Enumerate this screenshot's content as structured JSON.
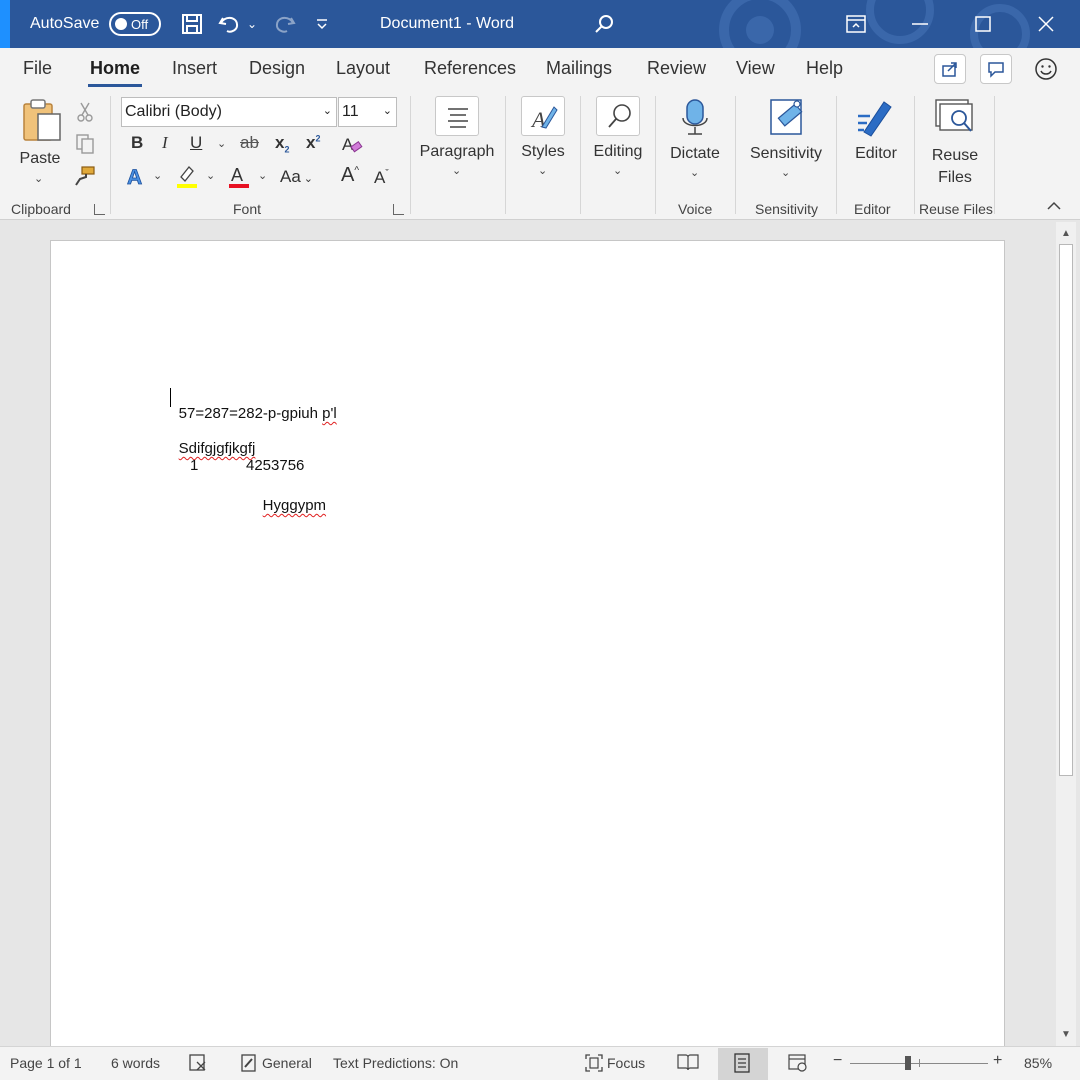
{
  "titlebar": {
    "autosave_label": "AutoSave",
    "autosave_state": "Off",
    "document_title": "Document1  -  Word",
    "accent_color": "#2b579a"
  },
  "tabs": [
    {
      "label": "File"
    },
    {
      "label": "Home",
      "active": true
    },
    {
      "label": "Insert"
    },
    {
      "label": "Design"
    },
    {
      "label": "Layout"
    },
    {
      "label": "References"
    },
    {
      "label": "Mailings"
    },
    {
      "label": "Review"
    },
    {
      "label": "View"
    },
    {
      "label": "Help"
    }
  ],
  "ribbon": {
    "clipboard": {
      "paste_label": "Paste",
      "group_label": "Clipboard"
    },
    "font": {
      "font_name": "Calibri (Body)",
      "font_size": "11",
      "group_label": "Font",
      "bold": "B",
      "italic": "I",
      "underline": "U",
      "strike": "ab",
      "subscript": "x",
      "superscript": "x",
      "case": "Aa",
      "grow": "A",
      "shrink": "A"
    },
    "paragraph": {
      "label": "Paragraph"
    },
    "styles": {
      "label": "Styles"
    },
    "editing": {
      "label": "Editing"
    },
    "voice": {
      "dictate_label": "Dictate",
      "group_label": "Voice"
    },
    "sensitivity": {
      "label": "Sensitivity",
      "group_label": "Sensitivity"
    },
    "editor": {
      "label": "Editor",
      "group_label": "Editor"
    },
    "reuse": {
      "label_line1": "Reuse",
      "label_line2": "Files",
      "group_label": "Reuse Files"
    }
  },
  "document": {
    "line1_a": "5",
    "line1_b": "7=287=282-p-gpiuh ",
    "line1_c": "p'l",
    "line2": "Sdifgjgfjkgfj",
    "list_number": "1",
    "list_value": "4253756",
    "list_word": "Hyggypm"
  },
  "statusbar": {
    "page": "Page 1 of 1",
    "words": "6 words",
    "general": "General",
    "predictions": "Text Predictions: On",
    "focus": "Focus",
    "zoom": "85%"
  }
}
